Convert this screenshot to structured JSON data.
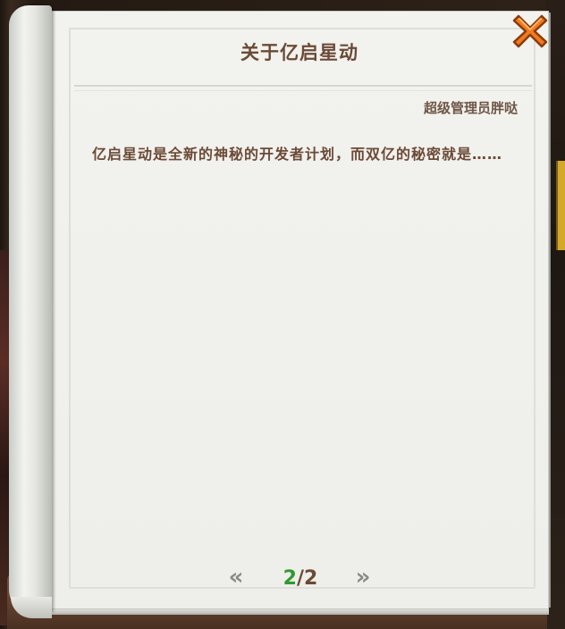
{
  "dialog": {
    "title": "关于亿启星动",
    "author": "超级管理员胖哒",
    "body": "亿启星动是全新的神秘的开发者计划，而双亿的秘密就是……"
  },
  "pager": {
    "prev_label": "«",
    "next_label": "»",
    "current": "2",
    "separator": "/",
    "total": "2"
  },
  "icons": {
    "close": "close-x-icon"
  },
  "colors": {
    "title_text": "#6b4a36",
    "current_page": "#2f9a2f",
    "close_button": "#f07a1e"
  }
}
